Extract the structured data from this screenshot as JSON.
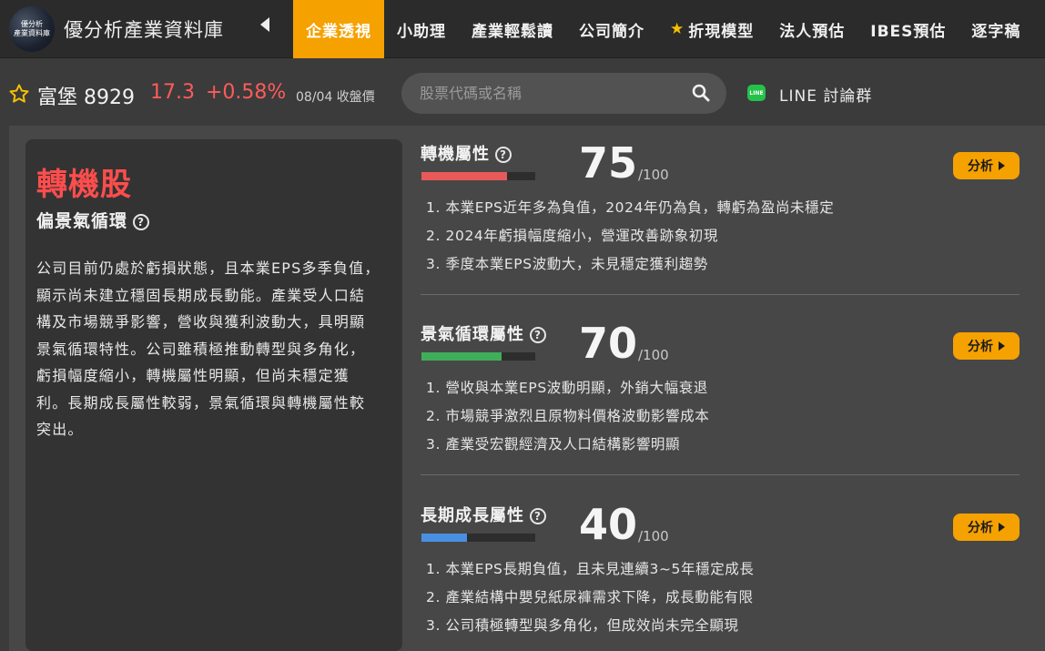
{
  "logo": {
    "line1": "優分析",
    "line2": "產業資料庫"
  },
  "brand": "優分析產業資料庫",
  "nav": {
    "tabs": [
      {
        "label": "企業透視",
        "active": true,
        "star": false
      },
      {
        "label": "小助理",
        "active": false,
        "star": false
      },
      {
        "label": "產業輕鬆讀",
        "active": false,
        "star": false
      },
      {
        "label": "公司簡介",
        "active": false,
        "star": false
      },
      {
        "label": "折現模型",
        "active": false,
        "star": true
      },
      {
        "label": "法人預估",
        "active": false,
        "star": false
      },
      {
        "label": "IBES預估",
        "active": false,
        "star": false
      },
      {
        "label": "逐字稿",
        "active": false,
        "star": false
      }
    ]
  },
  "stock": {
    "name_code": "富堡 8929",
    "price": "17.3",
    "change": "+0.58%",
    "date_label": "08/04 收盤價"
  },
  "search": {
    "placeholder": "股票代碼或名稱",
    "value": ""
  },
  "line_group": {
    "icon_text": "LINE",
    "label": "LINE 討論群"
  },
  "summary": {
    "type_title": "轉機股",
    "type_sub": "偏景氣循環",
    "text": "公司目前仍處於虧損狀態，且本業EPS多季負值，顯示尚未建立穩固長期成長動能。產業受人口結構及市場競爭影響，營收與獲利波動大，具明顯景氣循環特性。公司雖積極推動轉型與多角化，虧損幅度縮小，轉機屬性明顯，但尚未穩定獲利。長期成長屬性較弱，景氣循環與轉機屬性較突出。"
  },
  "attributes": [
    {
      "name": "轉機屬性",
      "score": "75",
      "max": "/100",
      "fill_pct": 75,
      "color": "#e85a5a",
      "button": "分析",
      "points": [
        "1. 本業EPS近年多為負值，2024年仍為負，轉虧為盈尚未穩定",
        "2. 2024年虧損幅度縮小，營運改善跡象初現",
        "3. 季度本業EPS波動大，未見穩定獲利趨勢"
      ]
    },
    {
      "name": "景氣循環屬性",
      "score": "70",
      "max": "/100",
      "fill_pct": 70,
      "color": "#3fae5a",
      "button": "分析",
      "points": [
        "1. 營收與本業EPS波動明顯，外銷大幅衰退",
        "2. 市場競爭激烈且原物料價格波動影響成本",
        "3. 產業受宏觀經濟及人口結構影響明顯"
      ]
    },
    {
      "name": "長期成長屬性",
      "score": "40",
      "max": "/100",
      "fill_pct": 40,
      "color": "#4a90e2",
      "button": "分析",
      "points": [
        "1. 本業EPS長期負值，且未見連續3~5年穩定成長",
        "2. 產業結構中嬰兒紙尿褲需求下降，成長動能有限",
        "3. 公司積極轉型與多角化，但成效尚未完全顯現"
      ]
    }
  ]
}
